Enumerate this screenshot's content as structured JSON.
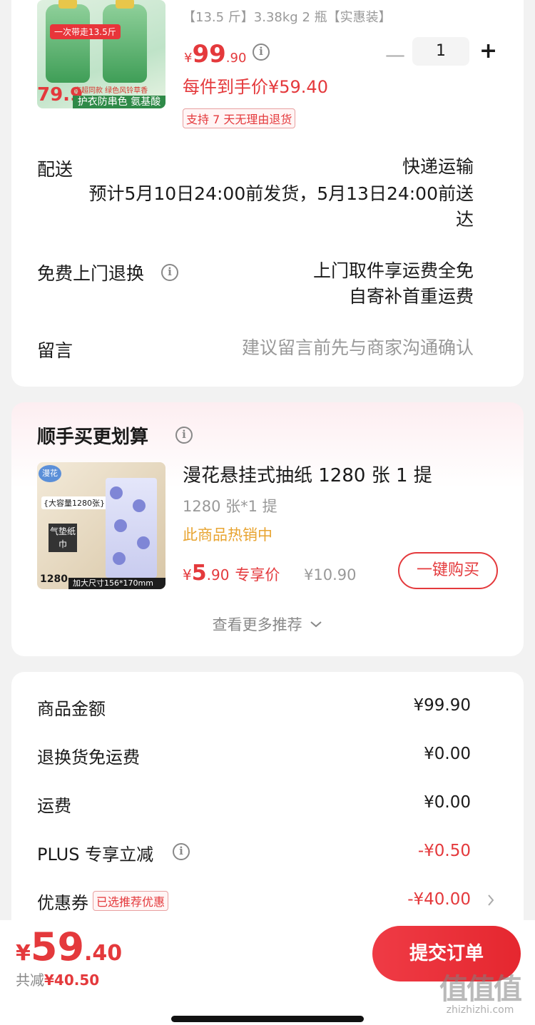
{
  "product": {
    "spec": "【13.5 斤】3.38kg 2 瓶【实惠装】",
    "image": {
      "red_tag": "一次带走13.5斤",
      "price": "79.9",
      "strip": "护衣防串色 氨基酸",
      "mini": "商超同款 绿色风铃草香"
    },
    "price_yen": "¥",
    "price_int": "99",
    "price_dec": ".90",
    "quantity": "1",
    "per_item_price": "每件到手价¥59.40",
    "return_badge": "支持 7 天无理由退货"
  },
  "delivery": {
    "label": "配送",
    "method": "快递运输",
    "estimate_line1": "预计5月10日24:00前发货，5月13日24:00前送",
    "estimate_line2": "达"
  },
  "free_return": {
    "label": "免费上门退换",
    "line1": "上门取件享运费全免",
    "line2": "自寄补首重运费"
  },
  "message": {
    "label": "留言",
    "placeholder": "建议留言前先与商家沟通确认"
  },
  "addon": {
    "title": "顺手买更划算",
    "image": {
      "logo": "漫花",
      "tag": "{大容量1280张}",
      "dark": "气垫纸巾",
      "big": "1280",
      "strip": "加大尺寸156*170mm"
    },
    "name": "漫花悬挂式抽纸 1280 张 1 提",
    "spec": "1280 张*1 提",
    "hot": "此商品热销中",
    "price_yen": "¥",
    "price": "5",
    "price_dec": ".90",
    "price_label": "专享价",
    "original_price": "¥10.90",
    "buy_button": "一键购买",
    "more_label": "查看更多推荐"
  },
  "summary": {
    "items": [
      {
        "label": "商品金额",
        "value": "¥99.90"
      },
      {
        "label": "退换货免运费",
        "value": "¥0.00"
      },
      {
        "label": "运费",
        "value": "¥0.00"
      },
      {
        "label": "PLUS 专享立减",
        "value": "-¥0.50"
      },
      {
        "label": "优惠券",
        "value": "-¥40.00"
      }
    ],
    "coupon_badge": "已选推荐优惠"
  },
  "footer": {
    "total_yen": "¥",
    "total_int": "59",
    "total_dec": ".40",
    "saved_label": "共减",
    "saved_value": "¥40.50",
    "submit_label": "提交订单"
  },
  "watermark": {
    "mark": "值值值",
    "site": "zhizhizhi.com"
  },
  "colors": {
    "accent": "#e4393c",
    "hot": "#e8a431",
    "background": "#f2f2f2"
  }
}
